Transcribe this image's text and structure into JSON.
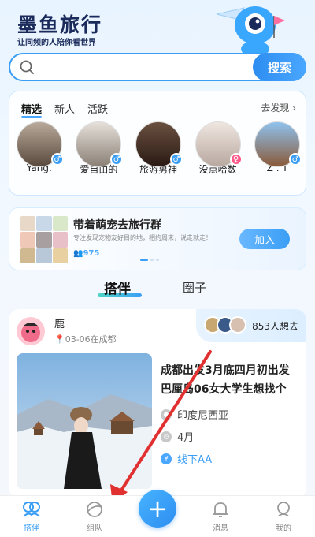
{
  "header": {
    "logo": "墨鱼旅行",
    "slogan": "让同频的人陪你看世界",
    "mascot_icon": "cyclops-mascot-icon"
  },
  "search": {
    "placeholder": "",
    "button_label": "搜索"
  },
  "users_section": {
    "tabs": [
      {
        "label": "精选",
        "active": true
      },
      {
        "label": "新人",
        "active": false
      },
      {
        "label": "活跃",
        "active": false
      }
    ],
    "discover_label": "去发现",
    "users": [
      {
        "name": "Yang.",
        "gender": "male",
        "badge_color": "#3a9ef5",
        "avatar_color": "#8a7a6a"
      },
      {
        "name": "爱自由的",
        "gender": "male",
        "badge_color": "#3a9ef5",
        "avatar_color": "#c8c0b8"
      },
      {
        "name": "旅游男神",
        "gender": "male",
        "badge_color": "#3a9ef5",
        "avatar_color": "#5a3a2a"
      },
      {
        "name": "没点哈数",
        "gender": "female",
        "badge_color": "#ff5a8a",
        "avatar_color": "#d8c8c0"
      },
      {
        "name": "Z . T",
        "gender": "male",
        "badge_color": "#3a9ef5",
        "avatar_color": "#7aa8d0"
      }
    ]
  },
  "banner": {
    "title": "带着萌宠去旅行群",
    "subtitle": "专注发现宠物友好目的地，相约周末，说走就走！",
    "member_count": "975",
    "join_label": "加入"
  },
  "section_tabs": {
    "partner": "搭伴",
    "circle": "圈子"
  },
  "post": {
    "author": "鹿",
    "meta": "03-06在成都",
    "want_count_text": "853人想去",
    "title": "成都出发3月底四月初出发巴厘岛06女大学生想找个",
    "destination": "印度尼西亚",
    "time": "4月",
    "price": "线下AA"
  },
  "bottom_nav": {
    "items": [
      {
        "label": "搭伴",
        "icon": "partner-icon",
        "active": true
      },
      {
        "label": "组队",
        "icon": "team-icon",
        "active": false
      },
      {
        "label": "消息",
        "icon": "bell-icon",
        "active": false
      },
      {
        "label": "我的",
        "icon": "profile-icon",
        "active": false
      }
    ]
  },
  "colors": {
    "accent": "#3a9ef5",
    "annotation_arrow": "#e03030"
  }
}
